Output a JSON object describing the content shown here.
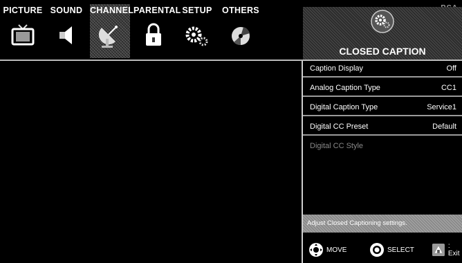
{
  "brand": "RCA",
  "tabs": [
    {
      "label": "PICTURE",
      "icon": "tv-icon"
    },
    {
      "label": "SOUND",
      "icon": "speaker-icon"
    },
    {
      "label": "CHANNEL",
      "icon": "satellite-icon"
    },
    {
      "label": "PARENTAL",
      "icon": "lock-icon"
    },
    {
      "label": "SETUP",
      "icon": "gears-icon"
    },
    {
      "label": "OTHERS",
      "icon": "disc-icon"
    }
  ],
  "panel": {
    "title": "CLOSED CAPTION",
    "icon": "gears-icon"
  },
  "menu": [
    {
      "label": "Caption Display",
      "value": "Off"
    },
    {
      "label": "Analog Caption Type",
      "value": "CC1"
    },
    {
      "label": "Digital Caption Type",
      "value": "Service1"
    },
    {
      "label": "Digital CC Preset",
      "value": "Default"
    },
    {
      "label": "Digital CC Style",
      "value": ""
    }
  ],
  "help_text": "Adjust Closed Captioning settings.",
  "controls": {
    "move": "MOVE",
    "select": "SELECT",
    "exit": ": Exit"
  }
}
